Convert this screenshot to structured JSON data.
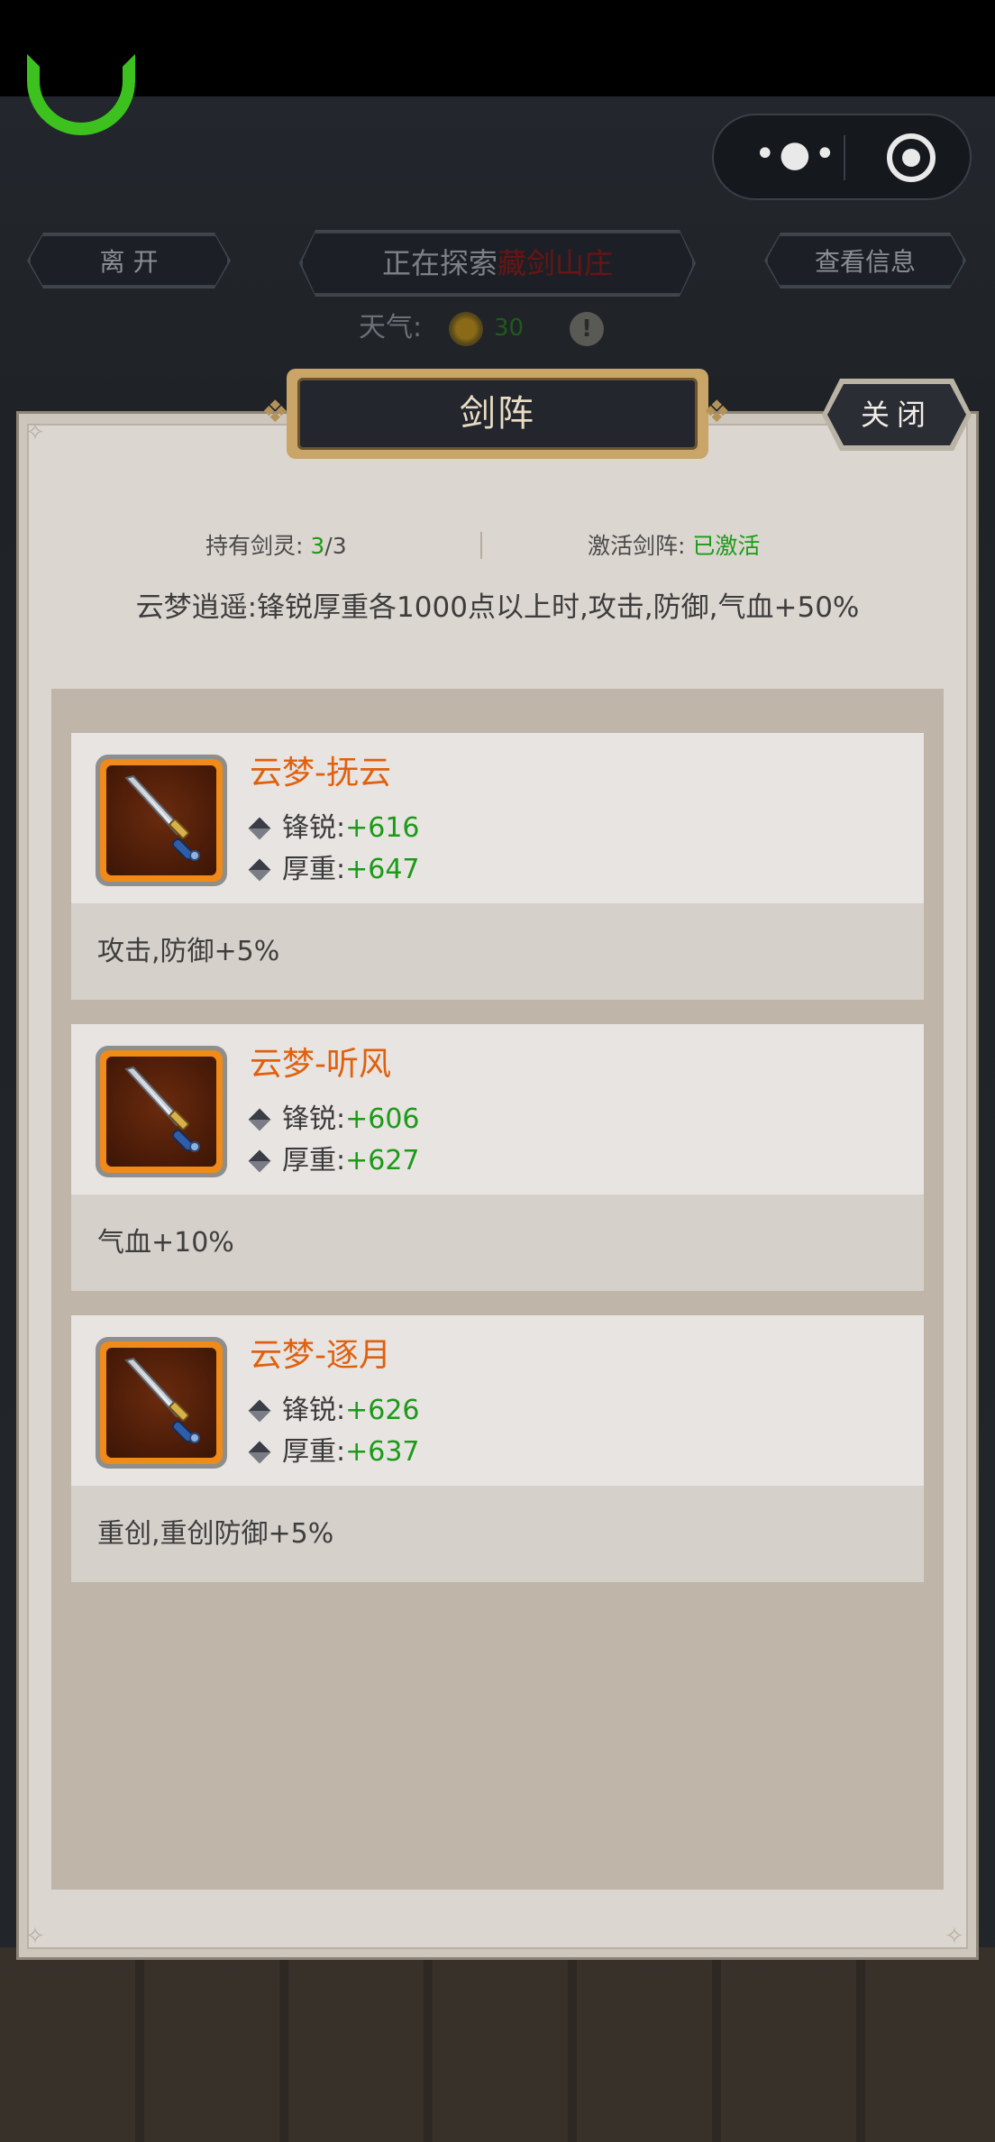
{
  "top_nav": {
    "leave_label": "离 开",
    "exploring_prefix": "正在探索",
    "exploring_place": "藏剑山庄",
    "info_label": "查看信息",
    "weather_label": "天气:",
    "weather_value": "30"
  },
  "capsule": {
    "more_icon": "more-dots-icon",
    "close_icon": "target-circle-icon"
  },
  "panel": {
    "title": "剑阵",
    "close_label": "关闭",
    "held_label": "持有剑灵:",
    "held_current": "3",
    "held_total": "/3",
    "activate_label": "激活剑阵:",
    "activate_status": "已激活",
    "formation_desc": "云梦逍遥:锋锐厚重各1000点以上时,攻击,防御,气血+50%"
  },
  "cards": [
    {
      "name": "云梦-抚云",
      "sharp_label": "锋锐:",
      "sharp_value": "+616",
      "heavy_label": "厚重:",
      "heavy_value": "+647",
      "bonus": "攻击,防御+5%"
    },
    {
      "name": "云梦-听风",
      "sharp_label": "锋锐:",
      "sharp_value": "+606",
      "heavy_label": "厚重:",
      "heavy_value": "+627",
      "bonus": "气血+10%"
    },
    {
      "name": "云梦-逐月",
      "sharp_label": "锋锐:",
      "sharp_value": "+626",
      "heavy_label": "厚重:",
      "heavy_value": "+637",
      "bonus": "重创,重创防御+5%"
    }
  ],
  "colors": {
    "accent_orange": "#e0600e",
    "value_green": "#1c9a18",
    "panel_bg": "#dcd6d1"
  }
}
